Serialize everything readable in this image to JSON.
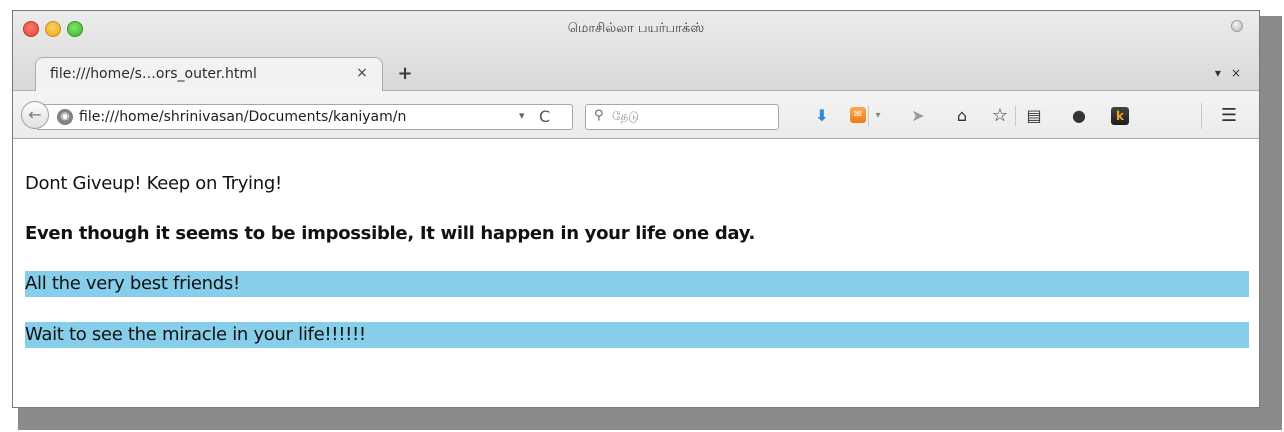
{
  "window": {
    "title": "மொசில்லா பயர்பாக்ஸ்"
  },
  "tabs": [
    {
      "label": "file:///home/s…ors_outer.html",
      "close": "×"
    }
  ],
  "tabstrip": {
    "new_tab": "+",
    "list_icon": "▾",
    "close_icon": "×"
  },
  "navbar": {
    "back_icon": "←",
    "url": "file:///home/shrinivasan/Documents/kaniyam/n",
    "url_dropdown": "▾",
    "reload_icon": "C",
    "search_placeholder": "தேடு"
  },
  "toolbar_icons": [
    "download-icon",
    "rss-icon",
    "share-icon",
    "home-icon",
    "bookmark-star-icon",
    "reader-icon",
    "chat-icon",
    "k-addon-icon",
    "menu-icon"
  ],
  "page": {
    "line1": "Dont Giveup! Keep on Trying!",
    "line2": "Even though it seems to be impossible, It will happen in your life one day.",
    "line3": "All the very best friends!",
    "line4": "Wait to see the miracle in your life!!!!!!"
  },
  "colors": {
    "highlight": "#87ceeb",
    "close_button": "#e0443a",
    "minimize_button": "#e6a61e",
    "maximize_button": "#3fb42a",
    "download_icon": "#2a8be0",
    "rss_icon": "#f07c10"
  }
}
